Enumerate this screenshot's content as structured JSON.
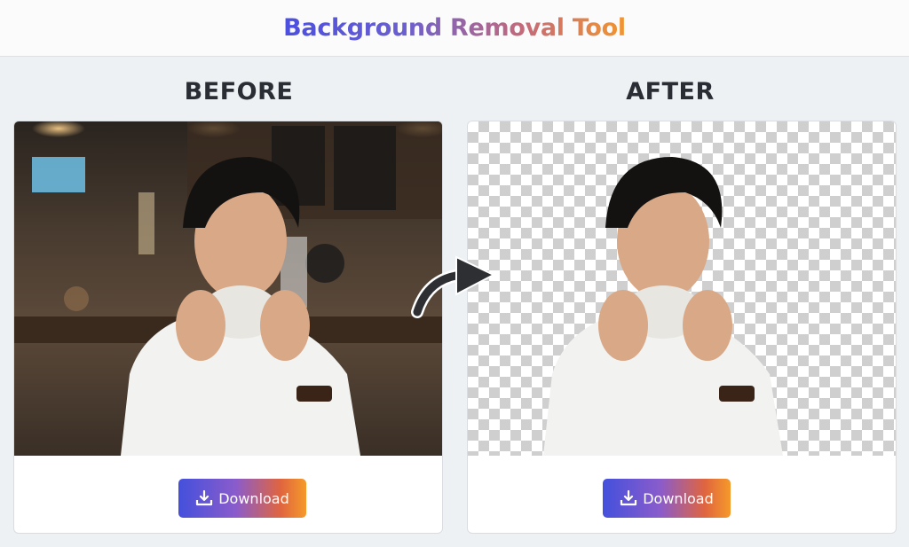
{
  "app": {
    "title": "Background Removal Tool"
  },
  "panels": {
    "before": {
      "heading": "BEFORE",
      "download_label": "Download"
    },
    "after": {
      "heading": "AFTER",
      "download_label": "Download"
    }
  },
  "icons": [
    "download-icon",
    "curved-arrow-icon"
  ],
  "colors": {
    "gradient_start": "#4450dc",
    "gradient_end": "#f59a2a",
    "heading": "#2a2d33",
    "checker": "#cfcfcf"
  }
}
